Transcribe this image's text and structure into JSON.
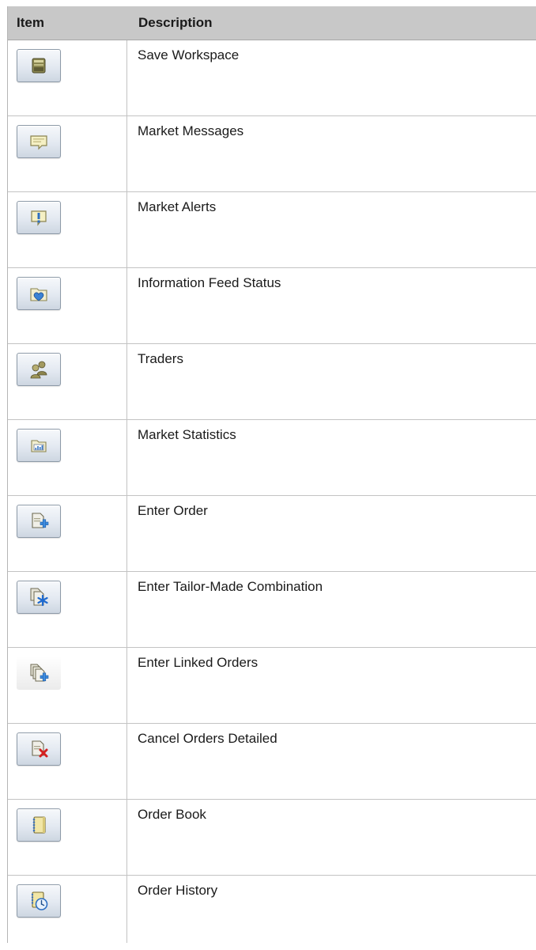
{
  "header": {
    "item": "Item",
    "description": "Description"
  },
  "rows": [
    {
      "icon": "save-workspace-icon",
      "description": "Save Workspace"
    },
    {
      "icon": "market-messages-icon",
      "description": "Market Messages"
    },
    {
      "icon": "market-alerts-icon",
      "description": "Market Alerts"
    },
    {
      "icon": "information-feed-status-icon",
      "description": "Information Feed Status"
    },
    {
      "icon": "traders-icon",
      "description": "Traders"
    },
    {
      "icon": "market-statistics-icon",
      "description": "Market Statistics"
    },
    {
      "icon": "enter-order-icon",
      "description": "Enter Order"
    },
    {
      "icon": "enter-tailor-made-combination-icon",
      "description": "Enter Tailor-Made Combination"
    },
    {
      "icon": "enter-linked-orders-icon",
      "description": "Enter Linked Orders"
    },
    {
      "icon": "cancel-orders-detailed-icon",
      "description": "Cancel Orders Detailed"
    },
    {
      "icon": "order-book-icon",
      "description": "Order Book"
    },
    {
      "icon": "order-history-icon",
      "description": "Order History"
    }
  ],
  "colors": {
    "header_bg": "#c8c8c8",
    "gridline": "#c3c3c3",
    "button_border": "#8d9aa8"
  }
}
